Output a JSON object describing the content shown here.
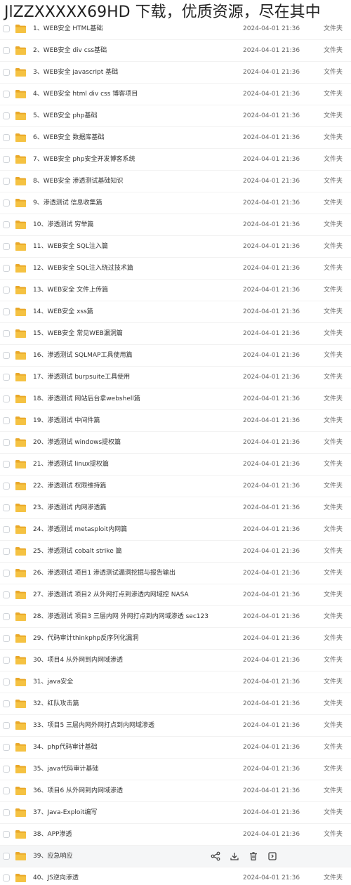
{
  "overlay": {
    "title": "JlZZXXXXX69HD 下载，优质资源，尽在其中"
  },
  "folder_type_label": "文件夹",
  "hovered_index": 38,
  "files": [
    {
      "name": "1、WEB安全 HTML基础",
      "date": "2024-04-01 21:36",
      "type": "文件夹"
    },
    {
      "name": "2、WEB安全 div css基础",
      "date": "2024-04-01 21:36",
      "type": "文件夹"
    },
    {
      "name": "3、WEB安全 javascript 基础",
      "date": "2024-04-01 21:36",
      "type": "文件夹"
    },
    {
      "name": "4、WEB安全 html div css 博客项目",
      "date": "2024-04-01 21:36",
      "type": "文件夹"
    },
    {
      "name": "5、WEB安全 php基础",
      "date": "2024-04-01 21:36",
      "type": "文件夹"
    },
    {
      "name": "6、WEB安全 数据库基础",
      "date": "2024-04-01 21:36",
      "type": "文件夹"
    },
    {
      "name": "7、WEB安全 php安全开发博客系统",
      "date": "2024-04-01 21:36",
      "type": "文件夹"
    },
    {
      "name": "8、WEB安全 渗透测试基础知识",
      "date": "2024-04-01 21:36",
      "type": "文件夹"
    },
    {
      "name": "9、渗透测试 信息收集篇",
      "date": "2024-04-01 21:36",
      "type": "文件夹"
    },
    {
      "name": "10、渗透测试 穷举篇",
      "date": "2024-04-01 21:36",
      "type": "文件夹"
    },
    {
      "name": "11、WEB安全 SQL注入篇",
      "date": "2024-04-01 21:36",
      "type": "文件夹"
    },
    {
      "name": "12、WEB安全 SQL注入绕过技术篇",
      "date": "2024-04-01 21:36",
      "type": "文件夹"
    },
    {
      "name": "13、WEB安全 文件上传篇",
      "date": "2024-04-01 21:36",
      "type": "文件夹"
    },
    {
      "name": "14、WEB安全 xss篇",
      "date": "2024-04-01 21:36",
      "type": "文件夹"
    },
    {
      "name": "15、WEB安全 常见WEB漏洞篇",
      "date": "2024-04-01 21:36",
      "type": "文件夹"
    },
    {
      "name": "16、渗透测试 SQLMAP工具使用篇",
      "date": "2024-04-01 21:36",
      "type": "文件夹"
    },
    {
      "name": "17、渗透测试 burpsuite工具使用",
      "date": "2024-04-01 21:36",
      "type": "文件夹"
    },
    {
      "name": "18、渗透测试 网站后台拿webshell篇",
      "date": "2024-04-01 21:36",
      "type": "文件夹"
    },
    {
      "name": "19、渗透测试 中间件篇",
      "date": "2024-04-01 21:36",
      "type": "文件夹"
    },
    {
      "name": "20、渗透测试 windows提权篇",
      "date": "2024-04-01 21:36",
      "type": "文件夹"
    },
    {
      "name": "21、渗透测试 linux提权篇",
      "date": "2024-04-01 21:36",
      "type": "文件夹"
    },
    {
      "name": "22、渗透测试 权限维持篇",
      "date": "2024-04-01 21:36",
      "type": "文件夹"
    },
    {
      "name": "23、渗透测试 内网渗透篇",
      "date": "2024-04-01 21:36",
      "type": "文件夹"
    },
    {
      "name": "24、渗透测试 metasploit内网篇",
      "date": "2024-04-01 21:36",
      "type": "文件夹"
    },
    {
      "name": "25、渗透测试 cobalt strike 篇",
      "date": "2024-04-01 21:36",
      "type": "文件夹"
    },
    {
      "name": "26、渗透测试 项目1 渗透测试漏洞挖掘与报告输出",
      "date": "2024-04-01 21:36",
      "type": "文件夹"
    },
    {
      "name": "27、渗透测试 项目2 从外网打点到渗透内网域控 NASA",
      "date": "2024-04-01 21:36",
      "type": "文件夹"
    },
    {
      "name": "28、渗透测试 项目3 三层内网 外网打点到内网域渗透 sec123",
      "date": "2024-04-01 21:36",
      "type": "文件夹"
    },
    {
      "name": "29、代码审计thinkphp反序列化漏洞",
      "date": "2024-04-01 21:36",
      "type": "文件夹"
    },
    {
      "name": "30、项目4 从外网到内网域渗透",
      "date": "2024-04-01 21:36",
      "type": "文件夹"
    },
    {
      "name": "31、java安全",
      "date": "2024-04-01 21:36",
      "type": "文件夹"
    },
    {
      "name": "32、红队攻击篇",
      "date": "2024-04-01 21:36",
      "type": "文件夹"
    },
    {
      "name": "33、项目5 三层内网外网打点到内网域渗透",
      "date": "2024-04-01 21:36",
      "type": "文件夹"
    },
    {
      "name": "34、php代码审计基础",
      "date": "2024-04-01 21:36",
      "type": "文件夹"
    },
    {
      "name": "35、java代码审计基础",
      "date": "2024-04-01 21:36",
      "type": "文件夹"
    },
    {
      "name": "36、项目6 从外网到内网域渗透",
      "date": "2024-04-01 21:36",
      "type": "文件夹"
    },
    {
      "name": "37、Java-Exploit编写",
      "date": "2024-04-01 21:36",
      "type": "文件夹"
    },
    {
      "name": "38、APP渗透",
      "date": "2024-04-01 21:36",
      "type": "文件夹"
    },
    {
      "name": "39、应急响应",
      "date": "",
      "type": ""
    },
    {
      "name": "40、JS逆向渗透",
      "date": "2024-04-01 21:36",
      "type": "文件夹"
    }
  ],
  "row_actions": [
    {
      "icon": "share-icon"
    },
    {
      "icon": "download-icon"
    },
    {
      "icon": "delete-icon"
    },
    {
      "icon": "more-icon"
    }
  ],
  "colors": {
    "folder": "#f5c242",
    "folder_dark": "#e9a829",
    "row_hover": "#f5f6f7",
    "text": "#333333",
    "muted": "#666666"
  }
}
